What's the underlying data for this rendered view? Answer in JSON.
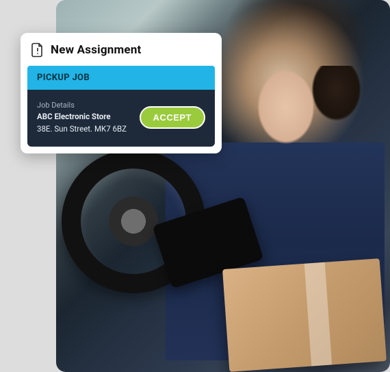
{
  "card": {
    "title": "New Assignment",
    "icon": "document-alert-icon",
    "jobTypeLabel": "PICKUP JOB",
    "detailsLabel": "Job Details",
    "storeName": "ABC Electronic Store",
    "address": "38E. Sun Street. MK7 6BZ",
    "acceptLabel": "ACCEPT"
  },
  "colors": {
    "jobTypeBar": "#22b4e6",
    "jobBody": "#1e2a3a",
    "accept": "#9acb3c"
  }
}
